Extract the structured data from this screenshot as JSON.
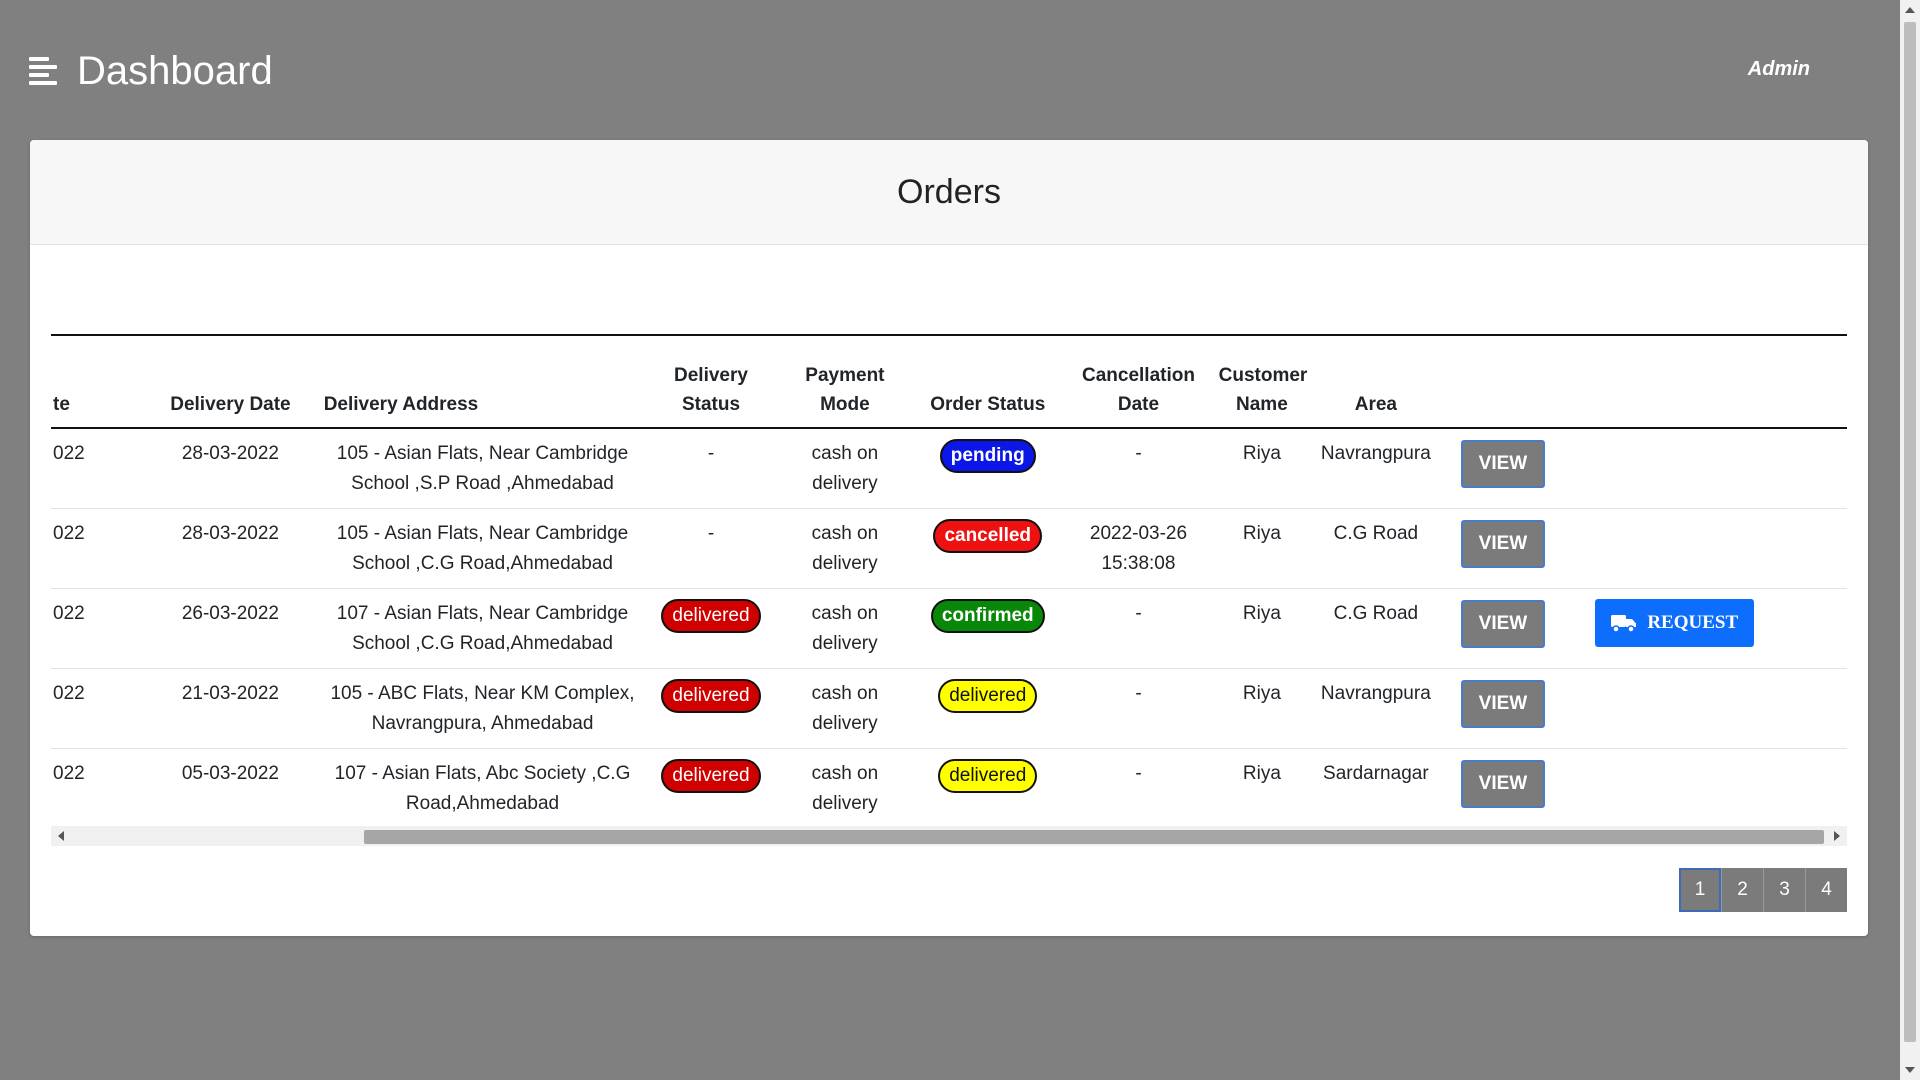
{
  "header": {
    "title": "Dashboard",
    "user": "Admin"
  },
  "card": {
    "title": "Orders"
  },
  "table": {
    "columns": [
      {
        "label": "Order Date",
        "visible_fragment": "te"
      },
      {
        "label": "Delivery Date"
      },
      {
        "label": "Delivery Address"
      },
      {
        "label": "Delivery Status"
      },
      {
        "label": "Payment Mode"
      },
      {
        "label": "Order Status"
      },
      {
        "label": "Cancellation Date"
      },
      {
        "label": "Customer Name"
      },
      {
        "label": "Area"
      }
    ],
    "rows": [
      {
        "order_date_fragment": "022",
        "delivery_date": "28-03-2022",
        "address": "105 - Asian Flats, Near Cambridge School ,S.P Road ,Ahmedabad",
        "delivery_status": "-",
        "payment_mode": "cash on delivery",
        "order_status": "pending",
        "cancellation_date": "-",
        "customer": "Riya",
        "area": "Navrangpura",
        "view_label": "VIEW"
      },
      {
        "order_date_fragment": "022",
        "delivery_date": "28-03-2022",
        "address": "105 - Asian Flats, Near Cambridge School ,C.G Road,Ahmedabad",
        "delivery_status": "-",
        "payment_mode": "cash on delivery",
        "order_status": "cancelled",
        "cancellation_date": "2022-03-26 15:38:08",
        "customer": "Riya",
        "area": "C.G Road",
        "view_label": "VIEW"
      },
      {
        "order_date_fragment": "022",
        "delivery_date": "26-03-2022",
        "address": "107 - Asian Flats, Near Cambridge School ,C.G Road,Ahmedabad",
        "delivery_status": "delivered",
        "payment_mode": "cash on delivery",
        "order_status": "confirmed",
        "cancellation_date": "-",
        "customer": "Riya",
        "area": "C.G Road",
        "view_label": "VIEW",
        "request_label": "REQUEST"
      },
      {
        "order_date_fragment": "022",
        "delivery_date": "21-03-2022",
        "address": "105 - ABC Flats, Near KM Complex, Navrangpura, Ahmedabad",
        "delivery_status": "delivered",
        "payment_mode": "cash on delivery",
        "order_status": "delivered",
        "cancellation_date": "-",
        "customer": "Riya",
        "area": "Navrangpura",
        "view_label": "VIEW"
      },
      {
        "order_date_fragment": "022",
        "delivery_date": "05-03-2022",
        "address": "107 - Asian Flats, Abc Society ,C.G Road,Ahmedabad",
        "delivery_status": "delivered",
        "payment_mode": "cash on delivery",
        "order_status": "delivered",
        "cancellation_date": "-",
        "customer": "Riya",
        "area": "Sardarnagar",
        "view_label": "VIEW"
      }
    ]
  },
  "pagination": {
    "pages": [
      "1",
      "2",
      "3",
      "4"
    ],
    "current": "1"
  },
  "colors": {
    "background": "#808080",
    "pending": "#0a17e6",
    "cancelled": "#ee1111",
    "confirmed": "#098709",
    "delivered_order": "#ffff00",
    "delivered_status": "#d00000",
    "request_button": "#0d6efd",
    "view_button": "#7b7b7b"
  },
  "icons": {
    "menu": "hamburger-menu-icon",
    "request": "truck-icon"
  }
}
